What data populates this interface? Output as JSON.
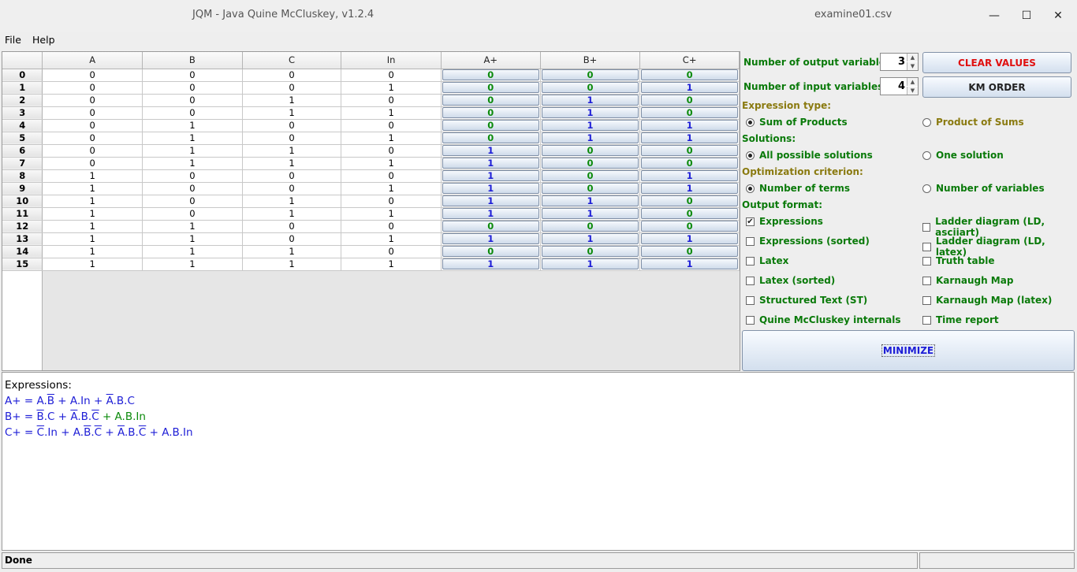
{
  "window": {
    "title": "JQM - Java Quine McCluskey, v1.2.4",
    "file": "examine01.csv",
    "min_glyph": "—",
    "max_glyph": "☐",
    "close_glyph": "✕"
  },
  "menu": {
    "file": "File",
    "help": "Help"
  },
  "table": {
    "headers": [
      "A",
      "B",
      "C",
      "In",
      "A+",
      "B+",
      "C+"
    ],
    "rows": [
      {
        "n": "0",
        "a": "0",
        "b": "0",
        "c": "0",
        "in": "0",
        "ap": "0",
        "bp": "0",
        "cp": "0"
      },
      {
        "n": "1",
        "a": "0",
        "b": "0",
        "c": "0",
        "in": "1",
        "ap": "0",
        "bp": "0",
        "cp": "1"
      },
      {
        "n": "2",
        "a": "0",
        "b": "0",
        "c": "1",
        "in": "0",
        "ap": "0",
        "bp": "1",
        "cp": "0"
      },
      {
        "n": "3",
        "a": "0",
        "b": "0",
        "c": "1",
        "in": "1",
        "ap": "0",
        "bp": "1",
        "cp": "0"
      },
      {
        "n": "4",
        "a": "0",
        "b": "1",
        "c": "0",
        "in": "0",
        "ap": "0",
        "bp": "1",
        "cp": "1"
      },
      {
        "n": "5",
        "a": "0",
        "b": "1",
        "c": "0",
        "in": "1",
        "ap": "0",
        "bp": "1",
        "cp": "1"
      },
      {
        "n": "6",
        "a": "0",
        "b": "1",
        "c": "1",
        "in": "0",
        "ap": "1",
        "bp": "0",
        "cp": "0"
      },
      {
        "n": "7",
        "a": "0",
        "b": "1",
        "c": "1",
        "in": "1",
        "ap": "1",
        "bp": "0",
        "cp": "0"
      },
      {
        "n": "8",
        "a": "1",
        "b": "0",
        "c": "0",
        "in": "0",
        "ap": "1",
        "bp": "0",
        "cp": "1"
      },
      {
        "n": "9",
        "a": "1",
        "b": "0",
        "c": "0",
        "in": "1",
        "ap": "1",
        "bp": "0",
        "cp": "1"
      },
      {
        "n": "10",
        "a": "1",
        "b": "0",
        "c": "1",
        "in": "0",
        "ap": "1",
        "bp": "1",
        "cp": "0"
      },
      {
        "n": "11",
        "a": "1",
        "b": "0",
        "c": "1",
        "in": "1",
        "ap": "1",
        "bp": "1",
        "cp": "0"
      },
      {
        "n": "12",
        "a": "1",
        "b": "1",
        "c": "0",
        "in": "0",
        "ap": "0",
        "bp": "0",
        "cp": "0"
      },
      {
        "n": "13",
        "a": "1",
        "b": "1",
        "c": "0",
        "in": "1",
        "ap": "1",
        "bp": "1",
        "cp": "1"
      },
      {
        "n": "14",
        "a": "1",
        "b": "1",
        "c": "1",
        "in": "0",
        "ap": "0",
        "bp": "0",
        "cp": "0"
      },
      {
        "n": "15",
        "a": "1",
        "b": "1",
        "c": "1",
        "in": "1",
        "ap": "1",
        "bp": "1",
        "cp": "1"
      }
    ]
  },
  "panel": {
    "num_output_label": "Number of output variables:",
    "num_output_value": "3",
    "num_input_label": "Number  of  input  variables:",
    "num_input_value": "4",
    "clear_values": "CLEAR VALUES",
    "km_order": "KM ORDER",
    "expression_type": "Expression type:",
    "sum_of_products": "Sum of Products",
    "product_of_sums": "Product of Sums",
    "solutions": "Solutions:",
    "all_solutions": "All possible solutions",
    "one_solution": "One solution",
    "optimization": "Optimization criterion:",
    "num_terms": "Number of terms",
    "num_variables": "Number of variables",
    "output_format": "Output format:",
    "checks": [
      {
        "label": "Expressions",
        "checked": "✔"
      },
      {
        "label": "Ladder diagram (LD, asciiart)",
        "checked": ""
      },
      {
        "label": "Expressions (sorted)",
        "checked": ""
      },
      {
        "label": "Ladder diagram (LD, latex)",
        "checked": ""
      },
      {
        "label": "Latex",
        "checked": ""
      },
      {
        "label": "Truth table",
        "checked": ""
      },
      {
        "label": "Latex (sorted)",
        "checked": ""
      },
      {
        "label": "Karnaugh Map",
        "checked": ""
      },
      {
        "label": "Structured Text (ST)",
        "checked": ""
      },
      {
        "label": "Karnaugh Map (latex)",
        "checked": ""
      },
      {
        "label": "Quine McCluskey internals",
        "checked": ""
      },
      {
        "label": "Time report",
        "checked": ""
      }
    ],
    "minimize": "MINIMIZE"
  },
  "output": {
    "heading": "Expressions:",
    "l1": {
      "p1": "A+ = A.",
      "b1": "B",
      "p2": " + A.In + ",
      "a1": "A",
      "p3": ".B.C"
    },
    "l2": {
      "b1": "B",
      "p0": "B+ = ",
      "p1": ".C + ",
      "a1": "A",
      "p2": ".B.",
      "c1": "C",
      "p3": " + A.B.In"
    },
    "l3": {
      "p0": "C+ = ",
      "c1": "C",
      "p1": ".In + A.",
      "b1": "B",
      "p2": ".",
      "c2": "C",
      "p3": " + ",
      "a1": "A",
      "p4": ".B.",
      "c3": "C",
      "p5": " + A.B.In"
    }
  },
  "status": {
    "text": "Done"
  }
}
